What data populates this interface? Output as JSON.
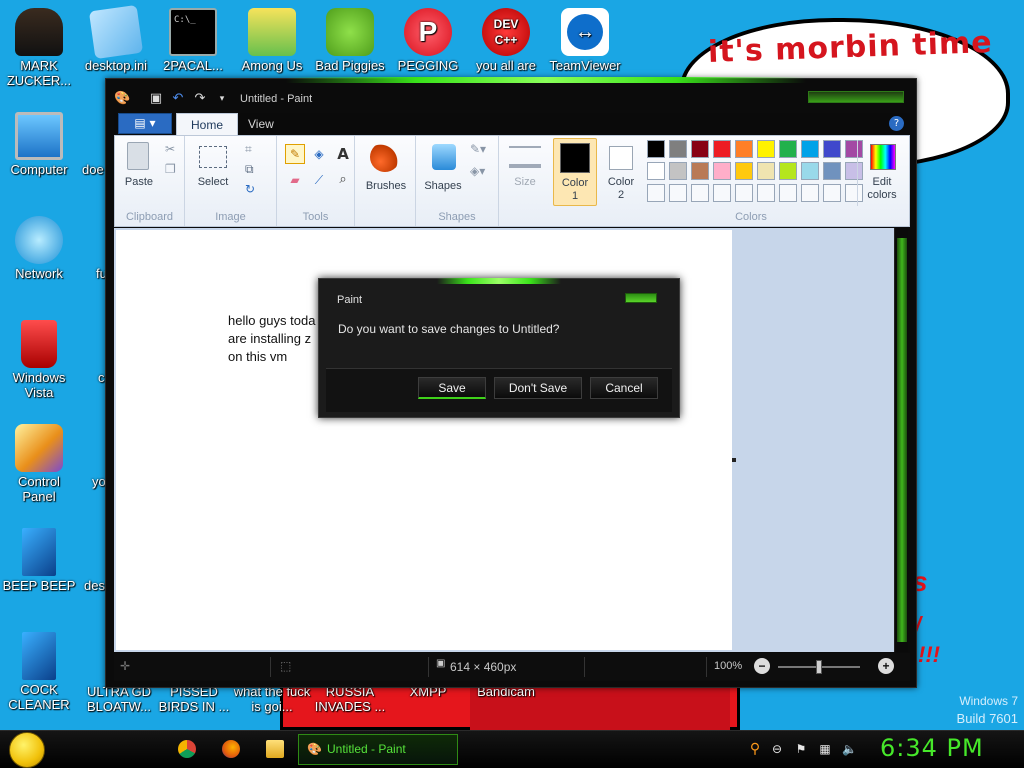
{
  "desktop": {
    "icons_top_row": [
      {
        "label": "MARK ZUCKER...",
        "icon": "person-icon"
      },
      {
        "label": "desktop.ini",
        "icon": "settings-file-icon"
      },
      {
        "label": "2PACAL...",
        "icon": "terminal-icon"
      },
      {
        "label": "Among Us",
        "icon": "among-us-icon"
      },
      {
        "label": "Bad Piggies",
        "icon": "pig-icon"
      },
      {
        "label": "PEGGING",
        "icon": "p-logo-icon"
      },
      {
        "label": "you all are",
        "icon": "devcpp-icon"
      },
      {
        "label": "TeamViewer",
        "icon": "teamviewer-icon"
      }
    ],
    "icons_left_column": [
      {
        "label": "Computer",
        "icon": "computer-icon"
      },
      {
        "label": "Network",
        "icon": "network-icon"
      },
      {
        "label": "Windows Vista",
        "icon": "recycle-bin-icon"
      },
      {
        "label": "Control Panel",
        "icon": "control-panel-icon"
      },
      {
        "label": "BEEP BEEP",
        "icon": "blue-file-icon"
      },
      {
        "label": "COCK CLEANER",
        "icon": "blue-file-icon"
      }
    ],
    "partial_labels_second_column": [
      "doe",
      "fu",
      "c",
      "yo",
      "des"
    ],
    "bottom_row_labels": [
      "ULTRA GD BLOATW...",
      "PISSED BIRDS IN ...",
      "what the fuck is goi...",
      "RUSSIA INVADES ...",
      "XMPP",
      "Bandicam"
    ],
    "speech_bubble": "it's morbin time",
    "watermark": {
      "line1": "Windows 7",
      "line2": "Build 7601"
    },
    "red_scrawl": [
      "s",
      "/",
      "!!!"
    ]
  },
  "paint": {
    "title": "Untitled - Paint",
    "tabs": [
      "Home",
      "View"
    ],
    "app_menu_icon": "menu-icon",
    "groups": {
      "clipboard": {
        "label": "Clipboard",
        "paste": "Paste"
      },
      "image": {
        "label": "Image",
        "select": "Select"
      },
      "tools": {
        "label": "Tools"
      },
      "brushes": {
        "label": "Brushes"
      },
      "shapes": {
        "label": "Shapes",
        "shapes_btn": "Shapes"
      },
      "size": {
        "label": "Size"
      },
      "color1": {
        "label": "Color 1",
        "line1": "Color",
        "line2": "1"
      },
      "color2": {
        "label": "Color 2",
        "line1": "Color",
        "line2": "2"
      },
      "colors": {
        "label": "Colors"
      },
      "edit_colors": {
        "line1": "Edit",
        "line2": "colors"
      }
    },
    "palette_row1": [
      "#000000",
      "#7f7f7f",
      "#880015",
      "#ed1c24",
      "#ff7f27",
      "#fff200",
      "#22b14c",
      "#00a2e8",
      "#3f48cc",
      "#a349a4"
    ],
    "palette_row2": [
      "#ffffff",
      "#c3c3c3",
      "#b97a57",
      "#ffaec9",
      "#ffc90e",
      "#efe4b0",
      "#b5e61d",
      "#99d9ea",
      "#7092be",
      "#c8bfe7"
    ],
    "canvas_text": [
      "hello guys toda",
      "are installing z",
      "on this vm"
    ],
    "status": {
      "dimensions": "614 × 460px",
      "zoom": "100%"
    }
  },
  "dialog": {
    "title": "Paint",
    "message": "Do you want to save changes to Untitled?",
    "buttons": {
      "save": "Save",
      "dont_save": "Don't Save",
      "cancel": "Cancel"
    }
  },
  "taskbar": {
    "active_app": "Untitled - Paint",
    "clock": "6:34 PM"
  }
}
